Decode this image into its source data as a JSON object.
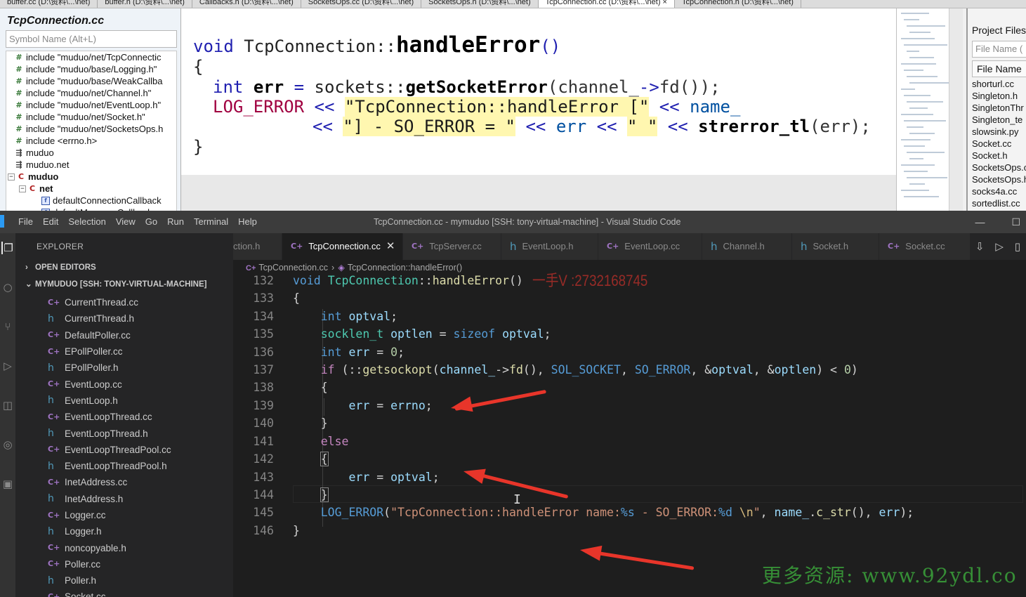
{
  "source_insight": {
    "tabs": [
      "buffer.cc (D:\\资料\\...\\net)",
      "buffer.h (D:\\资料\\...\\net)",
      "Callbacks.h (D:\\资料\\...\\net)",
      "SocketsOps.cc (D:\\资料\\...\\net)",
      "SocketsOps.h (D:\\资料\\...\\net)",
      "TcpConnection.cc (D:\\资料\\...\\net) ×",
      "TcpConnection.h (D:\\资料\\...\\net)"
    ],
    "symbol_panel": {
      "title": "TcpConnection.cc",
      "search_placeholder": "Symbol Name (Alt+L)",
      "items": [
        {
          "icon": "include-icon",
          "label": "include \"muduo/net/TcpConnectic"
        },
        {
          "icon": "include-icon",
          "label": "include \"muduo/base/Logging.h\""
        },
        {
          "icon": "include-icon",
          "label": "include \"muduo/base/WeakCallba"
        },
        {
          "icon": "include-icon",
          "label": "include \"muduo/net/Channel.h\""
        },
        {
          "icon": "include-icon",
          "label": "include \"muduo/net/EventLoop.h\""
        },
        {
          "icon": "include-icon",
          "label": "include \"muduo/net/Socket.h\""
        },
        {
          "icon": "include-icon",
          "label": "include \"muduo/net/SocketsOps.h"
        },
        {
          "icon": "include-icon",
          "label": "include <errno.h>"
        },
        {
          "icon": "namespace-icon",
          "label": "muduo"
        },
        {
          "icon": "namespace-icon",
          "label": "muduo.net"
        },
        {
          "icon": "class-icon",
          "label": "muduo",
          "toggle": "−"
        },
        {
          "icon": "class-icon",
          "label": "net",
          "toggle": "−"
        },
        {
          "icon": "function-icon",
          "label": "defaultConnectionCallback"
        },
        {
          "icon": "function-icon",
          "label": "defaultMessageCallback"
        }
      ]
    },
    "code": {
      "line1": {
        "kw": "void",
        "ns": "TcpConnection::",
        "fn": "handleError",
        "parens": "()"
      },
      "line2": "{",
      "line3": {
        "ty": "int",
        "var": "err",
        "eq": "=",
        "ns": "sockets::",
        "fn": "getSocketError",
        "rest1": "(channel_",
        "arrow": "->",
        "fd": "fd",
        "rest2": "());"
      },
      "line4": {
        "mac": "LOG_ERROR",
        "op": "<<",
        "str": "\"TcpConnection::handleError [\"",
        "op2": "<<",
        "name": "name_"
      },
      "line5": {
        "op": "<<",
        "str": "\"] - SO_ERROR = \"",
        "op2": "<<",
        "var": "err",
        "op3": "<<",
        "str2": "\" \"",
        "op4": "<<",
        "fn": "strerror_tl",
        "rest": "(err);"
      },
      "line6": "}"
    },
    "project_panel": {
      "header": "Project Files",
      "filter_placeholder": "File Name (",
      "column": "File Name",
      "files": [
        "shorturl.cc",
        "Singleton.h",
        "SingletonThr",
        "Singleton_te",
        "slowsink.py",
        "Socket.cc",
        "Socket.h",
        "SocketsOps.c",
        "SocketsOps.h",
        "socks4a.cc",
        "sortedlist.cc"
      ]
    }
  },
  "vscode": {
    "menu": [
      "File",
      "Edit",
      "Selection",
      "View",
      "Go",
      "Run",
      "Terminal",
      "Help"
    ],
    "window_title": "TcpConnection.cc - mymuduo [SSH: tony-virtual-machine] - Visual Studio Code",
    "window_controls": [
      "—",
      "☐"
    ],
    "explorer_title": "EXPLORER",
    "open_editors": "OPEN EDITORS",
    "workspace": "MYMUDUO [SSH: TONY-VIRTUAL-MACHINE]",
    "files": [
      {
        "type": "cc",
        "name": "CurrentThread.cc"
      },
      {
        "type": "h",
        "name": "CurrentThread.h"
      },
      {
        "type": "cc",
        "name": "DefaultPoller.cc"
      },
      {
        "type": "cc",
        "name": "EPollPoller.cc"
      },
      {
        "type": "h",
        "name": "EPollPoller.h"
      },
      {
        "type": "cc",
        "name": "EventLoop.cc"
      },
      {
        "type": "h",
        "name": "EventLoop.h"
      },
      {
        "type": "cc",
        "name": "EventLoopThread.cc"
      },
      {
        "type": "h",
        "name": "EventLoopThread.h"
      },
      {
        "type": "cc",
        "name": "EventLoopThreadPool.cc"
      },
      {
        "type": "h",
        "name": "EventLoopThreadPool.h"
      },
      {
        "type": "cc",
        "name": "InetAddress.cc"
      },
      {
        "type": "h",
        "name": "InetAddress.h"
      },
      {
        "type": "cc",
        "name": "Logger.cc"
      },
      {
        "type": "h",
        "name": "Logger.h"
      },
      {
        "type": "cc",
        "name": "noncopyable.h"
      },
      {
        "type": "cc",
        "name": "Poller.cc"
      },
      {
        "type": "h",
        "name": "Poller.h"
      },
      {
        "type": "cc",
        "name": "Socket.cc"
      }
    ],
    "tabs": [
      {
        "type": "none",
        "name": "ction.h"
      },
      {
        "type": "cc",
        "name": "TcpConnection.cc",
        "active": true
      },
      {
        "type": "cc",
        "name": "TcpServer.cc"
      },
      {
        "type": "h",
        "name": "EventLoop.h"
      },
      {
        "type": "cc",
        "name": "EventLoop.cc"
      },
      {
        "type": "h",
        "name": "Channel.h"
      },
      {
        "type": "h",
        "name": "Socket.h"
      },
      {
        "type": "cc",
        "name": "Socket.cc"
      }
    ],
    "breadcrumb": {
      "file": "TcpConnection.cc",
      "symbol": "TcpConnection::handleError()"
    },
    "line_numbers": [
      "132",
      "133",
      "134",
      "135",
      "136",
      "137",
      "138",
      "139",
      "140",
      "141",
      "142",
      "143",
      "144",
      "145",
      "146"
    ]
  },
  "watermarks": {
    "contact": "一手V :2732168745",
    "site": "更多资源: www.92ydl.co"
  }
}
